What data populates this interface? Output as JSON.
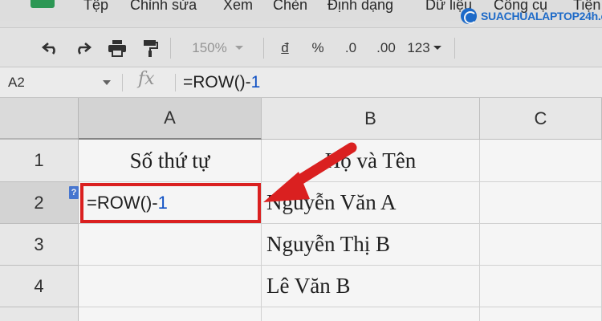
{
  "menu": {
    "items": [
      "Tệp",
      "Chỉnh sửa",
      "Xem",
      "Chèn",
      "Định dạng",
      "Dữ liệu",
      "Công cụ",
      "Tiện"
    ]
  },
  "watermark": {
    "text": "SUACHUALAPTOP24h.com"
  },
  "toolbar": {
    "zoom": "150%",
    "currency": "đ",
    "percent": "%",
    "dec_decrease": ".0",
    "dec_increase": ".00",
    "format": "123"
  },
  "formula_bar": {
    "cell_ref": "A2",
    "fx_label": "fx",
    "formula_prefix": "=ROW()-",
    "formula_number": "1"
  },
  "grid": {
    "columns": [
      "A",
      "B",
      "C"
    ],
    "rows": [
      "1",
      "2",
      "3",
      "4"
    ],
    "cells": {
      "A1": "Số thứ tự",
      "B1": "Họ và Tên",
      "B2": "Nguyễn Văn A",
      "B3": "Nguyễn Thị B",
      "B4": "Lê Văn B"
    },
    "active_cell": {
      "prefix": "=ROW()-",
      "number": "1"
    },
    "help_badge": "?"
  },
  "colors": {
    "highlight": "#e32222",
    "formula_number": "#1155cc",
    "watermark": "#1f6fd1"
  }
}
